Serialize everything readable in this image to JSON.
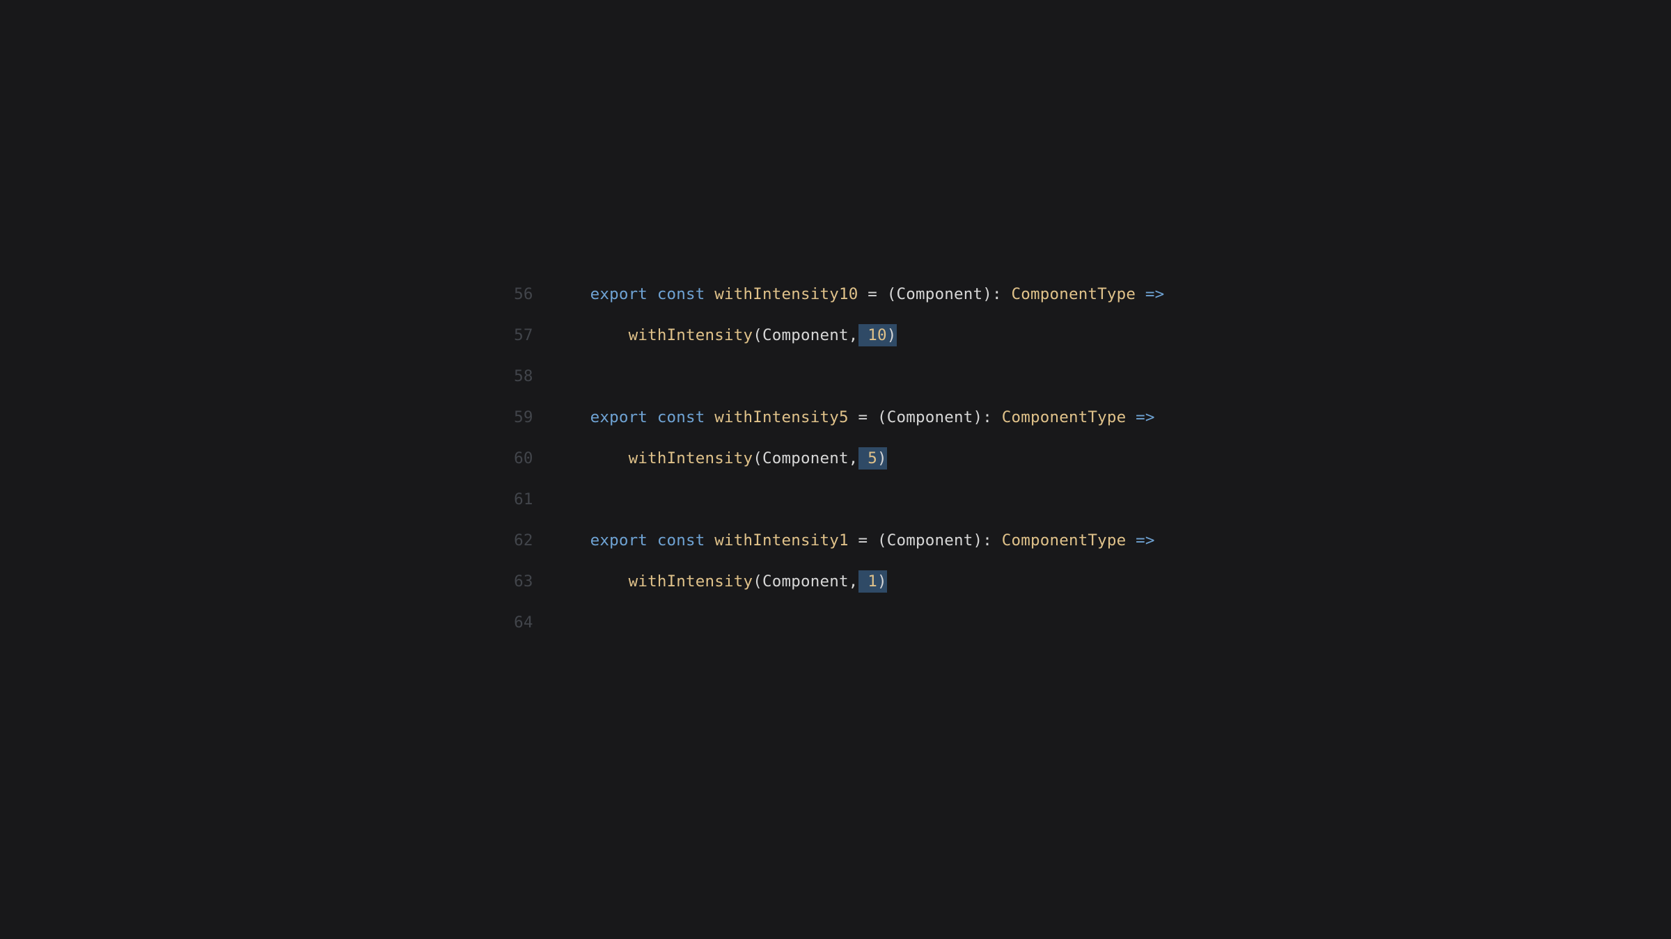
{
  "lines": [
    {
      "num": "56",
      "tokens": [
        {
          "cls": "kw-export",
          "t": "export"
        },
        {
          "cls": "punct",
          "t": " "
        },
        {
          "cls": "kw-const",
          "t": "const"
        },
        {
          "cls": "punct",
          "t": " "
        },
        {
          "cls": "fn-name",
          "t": "withIntensity10"
        },
        {
          "cls": "punct",
          "t": " "
        },
        {
          "cls": "eq",
          "t": "="
        },
        {
          "cls": "punct",
          "t": " ("
        },
        {
          "cls": "param",
          "t": "Component"
        },
        {
          "cls": "punct",
          "t": "): "
        },
        {
          "cls": "type",
          "t": "ComponentType"
        },
        {
          "cls": "punct",
          "t": " "
        },
        {
          "cls": "arrow",
          "t": "=>"
        }
      ]
    },
    {
      "num": "57",
      "indent": "    ",
      "tokens": [
        {
          "cls": "fn-call",
          "t": "withIntensity"
        },
        {
          "cls": "punct",
          "t": "("
        },
        {
          "cls": "param",
          "t": "Component"
        },
        {
          "cls": "punct",
          "t": ","
        },
        {
          "cls": "sel",
          "t": " "
        },
        {
          "cls": "sel num",
          "t": "10"
        },
        {
          "cls": "sel punct",
          "t": ")"
        }
      ]
    },
    {
      "num": "58",
      "tokens": []
    },
    {
      "num": "59",
      "tokens": [
        {
          "cls": "kw-export",
          "t": "export"
        },
        {
          "cls": "punct",
          "t": " "
        },
        {
          "cls": "kw-const",
          "t": "const"
        },
        {
          "cls": "punct",
          "t": " "
        },
        {
          "cls": "fn-name",
          "t": "withIntensity5"
        },
        {
          "cls": "punct",
          "t": " "
        },
        {
          "cls": "eq",
          "t": "="
        },
        {
          "cls": "punct",
          "t": " ("
        },
        {
          "cls": "param",
          "t": "Component"
        },
        {
          "cls": "punct",
          "t": "): "
        },
        {
          "cls": "type",
          "t": "ComponentType"
        },
        {
          "cls": "punct",
          "t": " "
        },
        {
          "cls": "arrow",
          "t": "=>"
        }
      ]
    },
    {
      "num": "60",
      "indent": "    ",
      "tokens": [
        {
          "cls": "fn-call",
          "t": "withIntensity"
        },
        {
          "cls": "punct",
          "t": "("
        },
        {
          "cls": "param",
          "t": "Component"
        },
        {
          "cls": "punct",
          "t": ","
        },
        {
          "cls": "sel",
          "t": " "
        },
        {
          "cls": "sel num",
          "t": "5"
        },
        {
          "cls": "sel punct",
          "t": ")"
        }
      ]
    },
    {
      "num": "61",
      "tokens": []
    },
    {
      "num": "62",
      "tokens": [
        {
          "cls": "kw-export",
          "t": "export"
        },
        {
          "cls": "punct",
          "t": " "
        },
        {
          "cls": "kw-const",
          "t": "const"
        },
        {
          "cls": "punct",
          "t": " "
        },
        {
          "cls": "fn-name",
          "t": "withIntensity1"
        },
        {
          "cls": "punct",
          "t": " "
        },
        {
          "cls": "eq",
          "t": "="
        },
        {
          "cls": "punct",
          "t": " ("
        },
        {
          "cls": "param",
          "t": "Component"
        },
        {
          "cls": "punct",
          "t": "): "
        },
        {
          "cls": "type",
          "t": "ComponentType"
        },
        {
          "cls": "punct",
          "t": " "
        },
        {
          "cls": "arrow",
          "t": "=>"
        }
      ]
    },
    {
      "num": "63",
      "indent": "    ",
      "tokens": [
        {
          "cls": "fn-call",
          "t": "withIntensity"
        },
        {
          "cls": "punct",
          "t": "("
        },
        {
          "cls": "param",
          "t": "Component"
        },
        {
          "cls": "punct",
          "t": ","
        },
        {
          "cls": "sel",
          "t": " "
        },
        {
          "cls": "sel num",
          "t": "1"
        },
        {
          "cls": "sel punct",
          "t": ")"
        }
      ]
    },
    {
      "num": "64",
      "tokens": []
    }
  ]
}
